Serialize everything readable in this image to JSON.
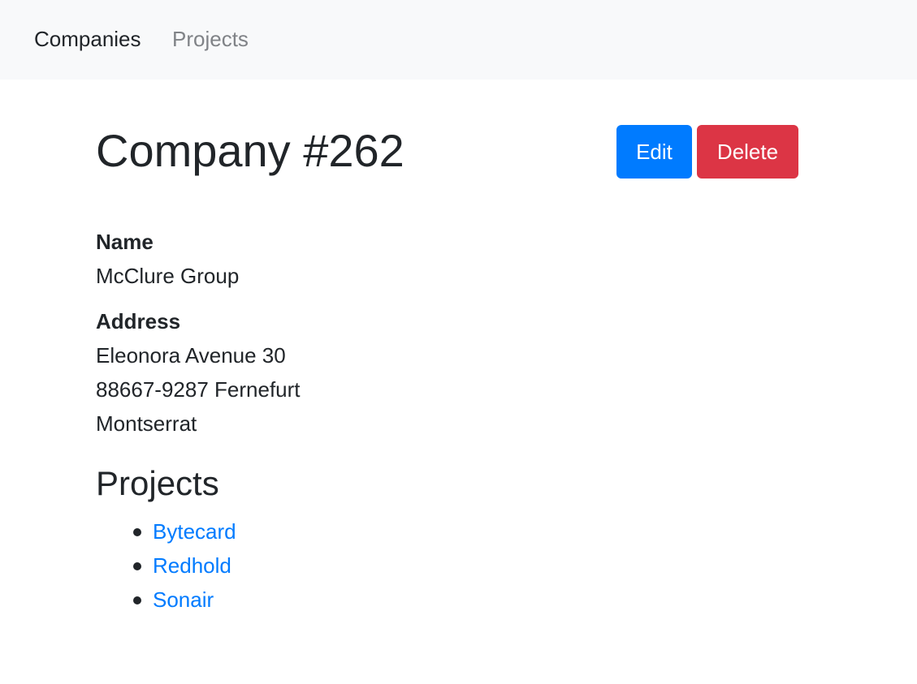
{
  "nav": {
    "items": [
      {
        "label": "Companies",
        "active": true
      },
      {
        "label": "Projects",
        "active": false
      }
    ]
  },
  "page": {
    "title": "Company #262",
    "edit_label": "Edit",
    "delete_label": "Delete"
  },
  "company": {
    "name_label": "Name",
    "name": "McClure Group",
    "address_label": "Address",
    "address_lines": [
      "Eleonora Avenue 30",
      "88667-9287 Fernefurt",
      "Montserrat"
    ]
  },
  "projects": {
    "title": "Projects",
    "items": [
      "Bytecard",
      "Redhold",
      "Sonair"
    ]
  },
  "colors": {
    "primary": "#007bff",
    "danger": "#dc3545",
    "navbar_bg": "#f8f9fa",
    "text": "#212529",
    "muted_nav": "#808387"
  }
}
